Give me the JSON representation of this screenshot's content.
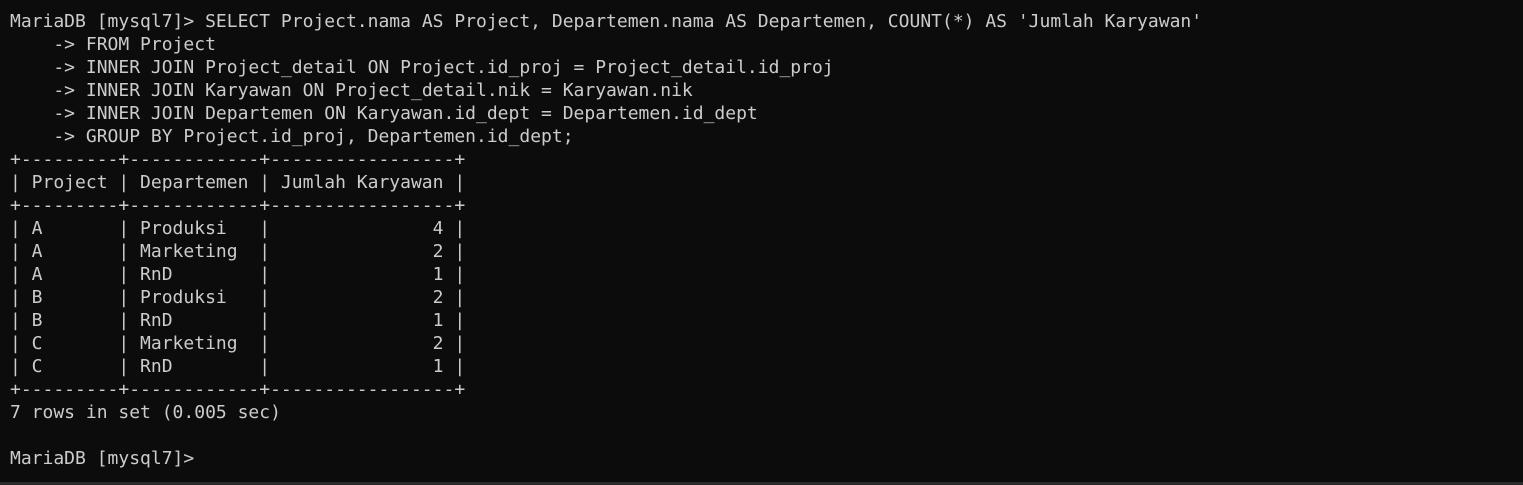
{
  "prompt": "MariaDB [mysql7]>",
  "query": {
    "first_line": "SELECT Project.nama AS Project, Departemen.nama AS Departemen, COUNT(*) AS 'Jumlah Karyawan'",
    "continuation_prefix": "    ->",
    "continuation_lines": [
      "FROM Project",
      "INNER JOIN Project_detail ON Project.id_proj = Project_detail.id_proj",
      "INNER JOIN Karyawan ON Project_detail.nik = Karyawan.nik",
      "INNER JOIN Departemen ON Karyawan.id_dept = Departemen.id_dept",
      "GROUP BY Project.id_proj, Departemen.id_dept;"
    ]
  },
  "result_table": {
    "border_line": "+---------+------------+-----------------+",
    "header_line": "| Project | Departemen | Jumlah Karyawan |",
    "columns": [
      "Project",
      "Departemen",
      "Jumlah Karyawan"
    ],
    "rows": [
      {
        "project": "A",
        "departemen": "Produksi",
        "jumlah": "4",
        "text": "| A       | Produksi   |               4 |"
      },
      {
        "project": "A",
        "departemen": "Marketing",
        "jumlah": "2",
        "text": "| A       | Marketing  |               2 |"
      },
      {
        "project": "A",
        "departemen": "RnD",
        "jumlah": "1",
        "text": "| A       | RnD        |               1 |"
      },
      {
        "project": "B",
        "departemen": "Produksi",
        "jumlah": "2",
        "text": "| B       | Produksi   |               2 |"
      },
      {
        "project": "B",
        "departemen": "RnD",
        "jumlah": "1",
        "text": "| B       | RnD        |               1 |"
      },
      {
        "project": "C",
        "departemen": "Marketing",
        "jumlah": "2",
        "text": "| C       | Marketing  |               2 |"
      },
      {
        "project": "C",
        "departemen": "RnD",
        "jumlah": "1",
        "text": "| C       | RnD        |               1 |"
      }
    ]
  },
  "status_line": "7 rows in set (0.005 sec)",
  "final_prompt": "MariaDB [mysql7]>",
  "colors": {
    "background": "#0c0c0c",
    "foreground": "#cccccc"
  }
}
